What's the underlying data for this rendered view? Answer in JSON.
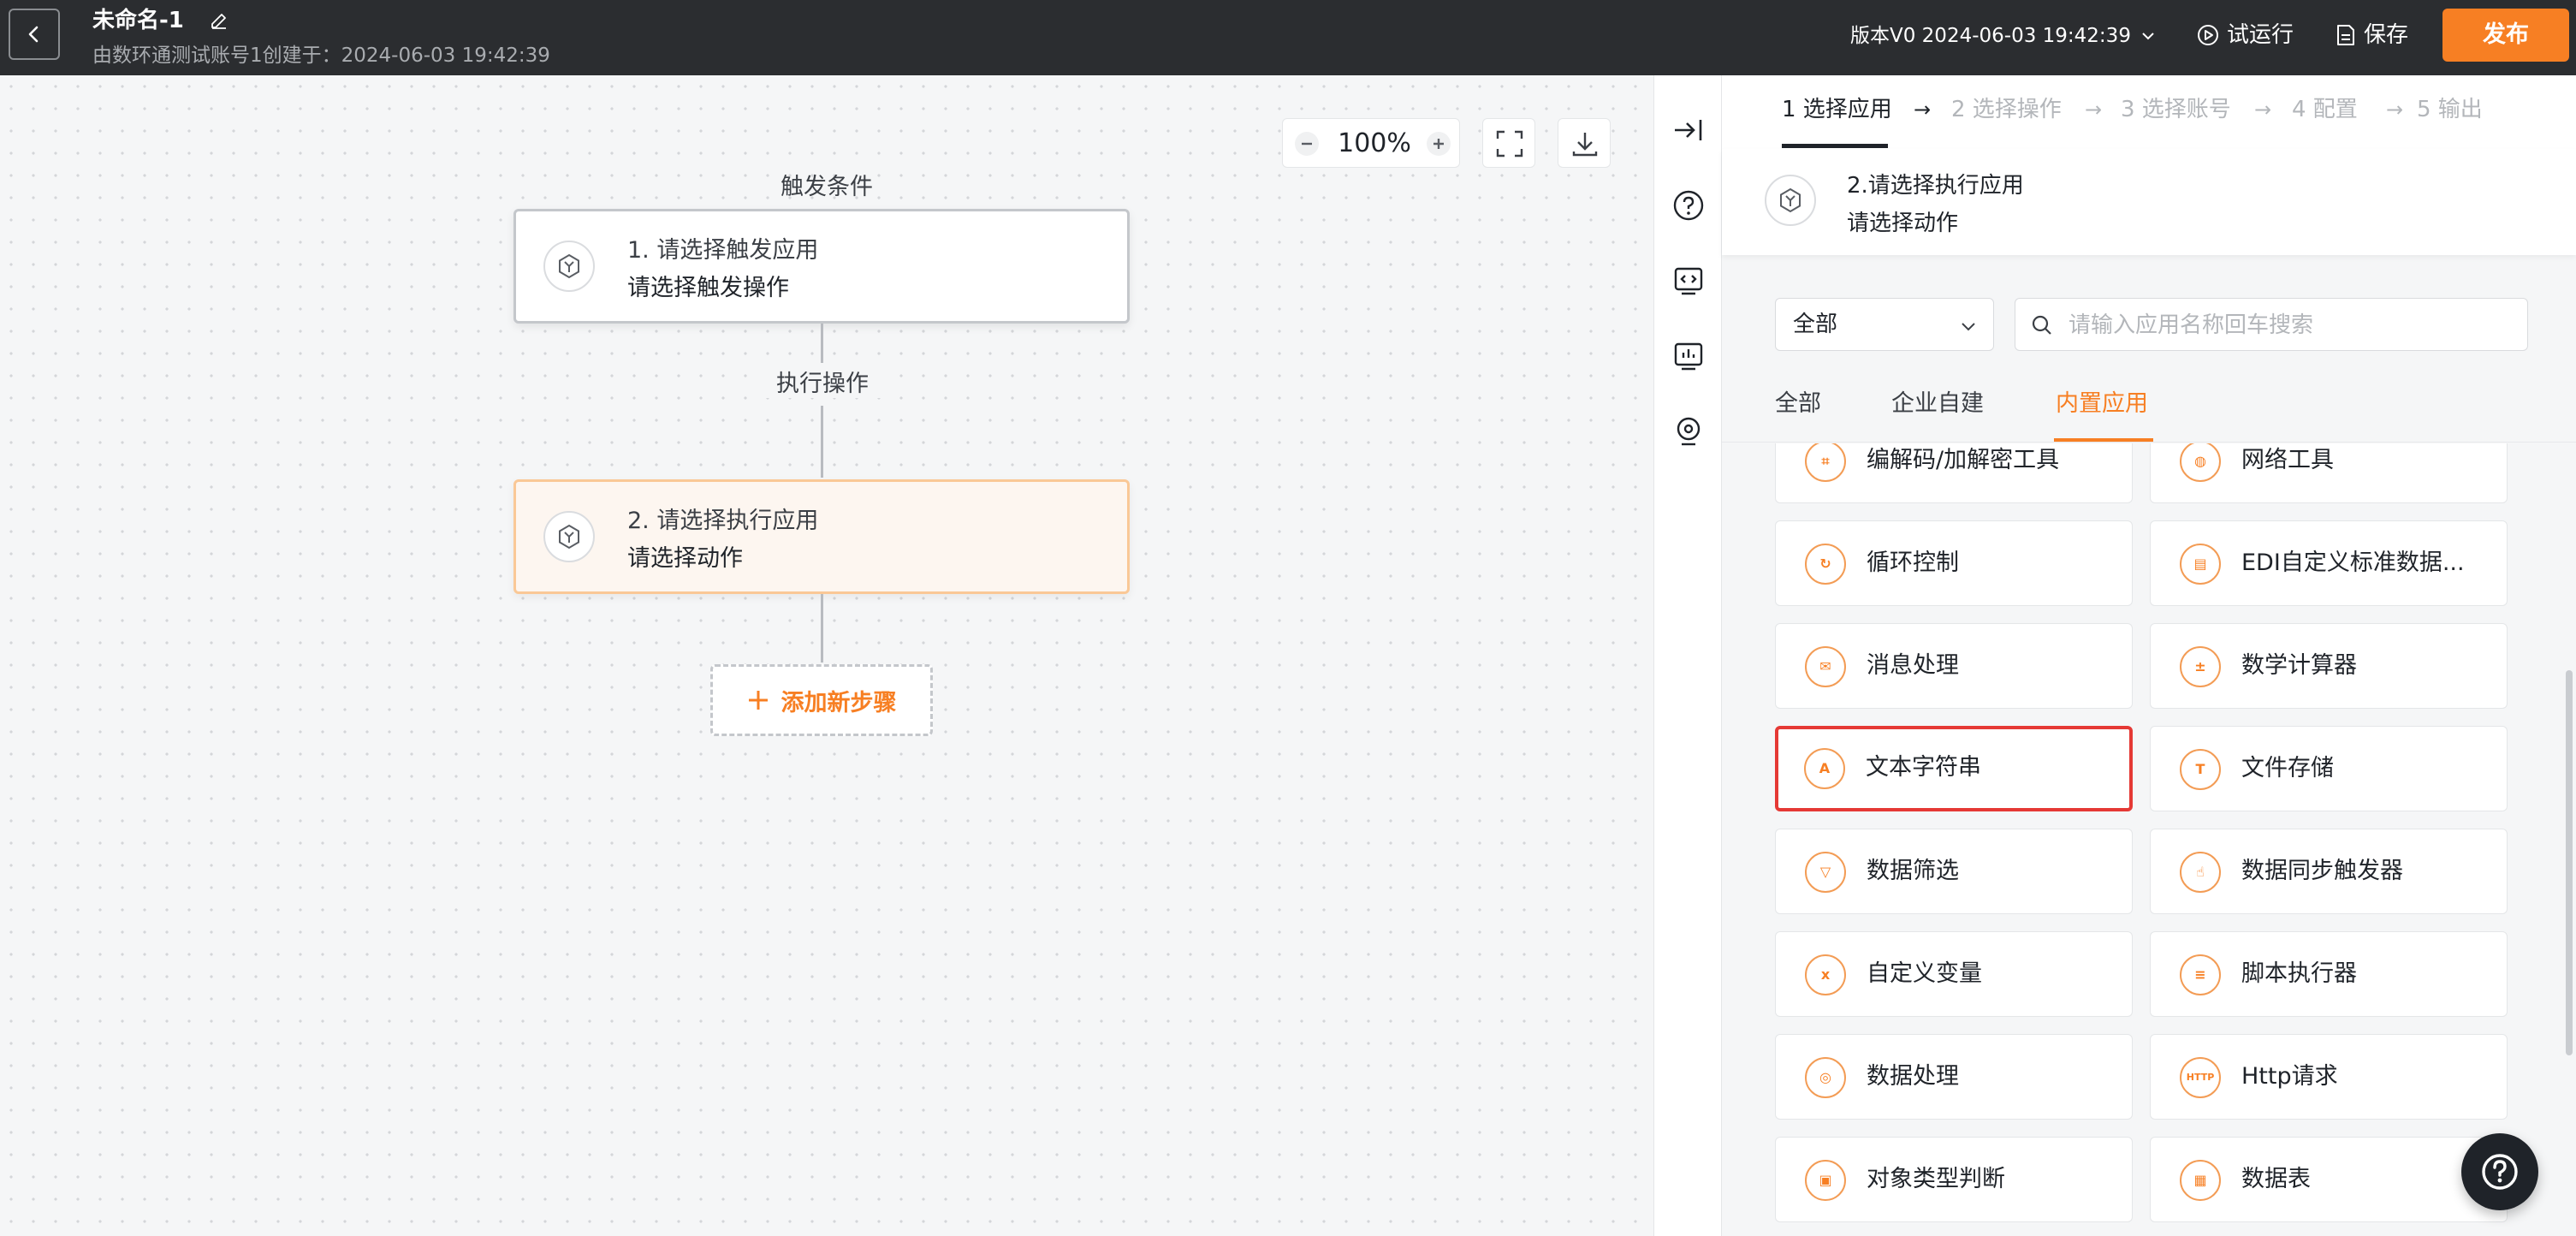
{
  "header": {
    "title": "未命名-1",
    "subtitle": "由数环通测试账号1创建于：2024-06-03 19:42:39",
    "version": "版本V0 2024-06-03 19:42:39",
    "trial_run": "试运行",
    "save": "保存",
    "publish": "发布"
  },
  "canvas": {
    "zoom": "100%",
    "trigger_label": "触发条件",
    "exec_label": "执行操作",
    "node1": {
      "title": "1. 请选择触发应用",
      "sub": "请选择触发操作"
    },
    "node2": {
      "title": "2. 请选择执行应用",
      "sub": "请选择动作"
    },
    "add_step": "添加新步骤"
  },
  "panel": {
    "steps": [
      "1 选择应用",
      "2 选择操作",
      "3 选择账号",
      "4 配置",
      "5 输出"
    ],
    "app_name": "2.请选择执行应用",
    "app_action": "请选择动作",
    "category": "全部",
    "search_placeholder": "请输入应用名称回车搜索",
    "tabs": [
      "全部",
      "企业自建",
      "内置应用"
    ],
    "apps": [
      {
        "label": "编解码/加解密工具",
        "icon": "encode-icon"
      },
      {
        "label": "网络工具",
        "icon": "globe-icon"
      },
      {
        "label": "循环控制",
        "icon": "loop-icon"
      },
      {
        "label": "EDI自定义标准数据...",
        "icon": "edi-icon"
      },
      {
        "label": "消息处理",
        "icon": "message-icon"
      },
      {
        "label": "数学计算器",
        "icon": "calculator-icon"
      },
      {
        "label": "文本字符串",
        "icon": "text-icon"
      },
      {
        "label": "文件存储",
        "icon": "file-storage-icon"
      },
      {
        "label": "数据筛选",
        "icon": "filter-icon"
      },
      {
        "label": "数据同步触发器",
        "icon": "sync-trigger-icon"
      },
      {
        "label": "自定义变量",
        "icon": "variable-icon"
      },
      {
        "label": "脚本执行器",
        "icon": "script-icon"
      },
      {
        "label": "数据处理",
        "icon": "database-icon"
      },
      {
        "label": "Http请求",
        "icon": "http-icon"
      },
      {
        "label": "对象类型判断",
        "icon": "object-type-icon"
      },
      {
        "label": "数据表",
        "icon": "data-table-icon"
      }
    ]
  },
  "colors": {
    "accent": "#f77f23",
    "highlight": "#e53935",
    "header_bg": "#2b2d30"
  }
}
